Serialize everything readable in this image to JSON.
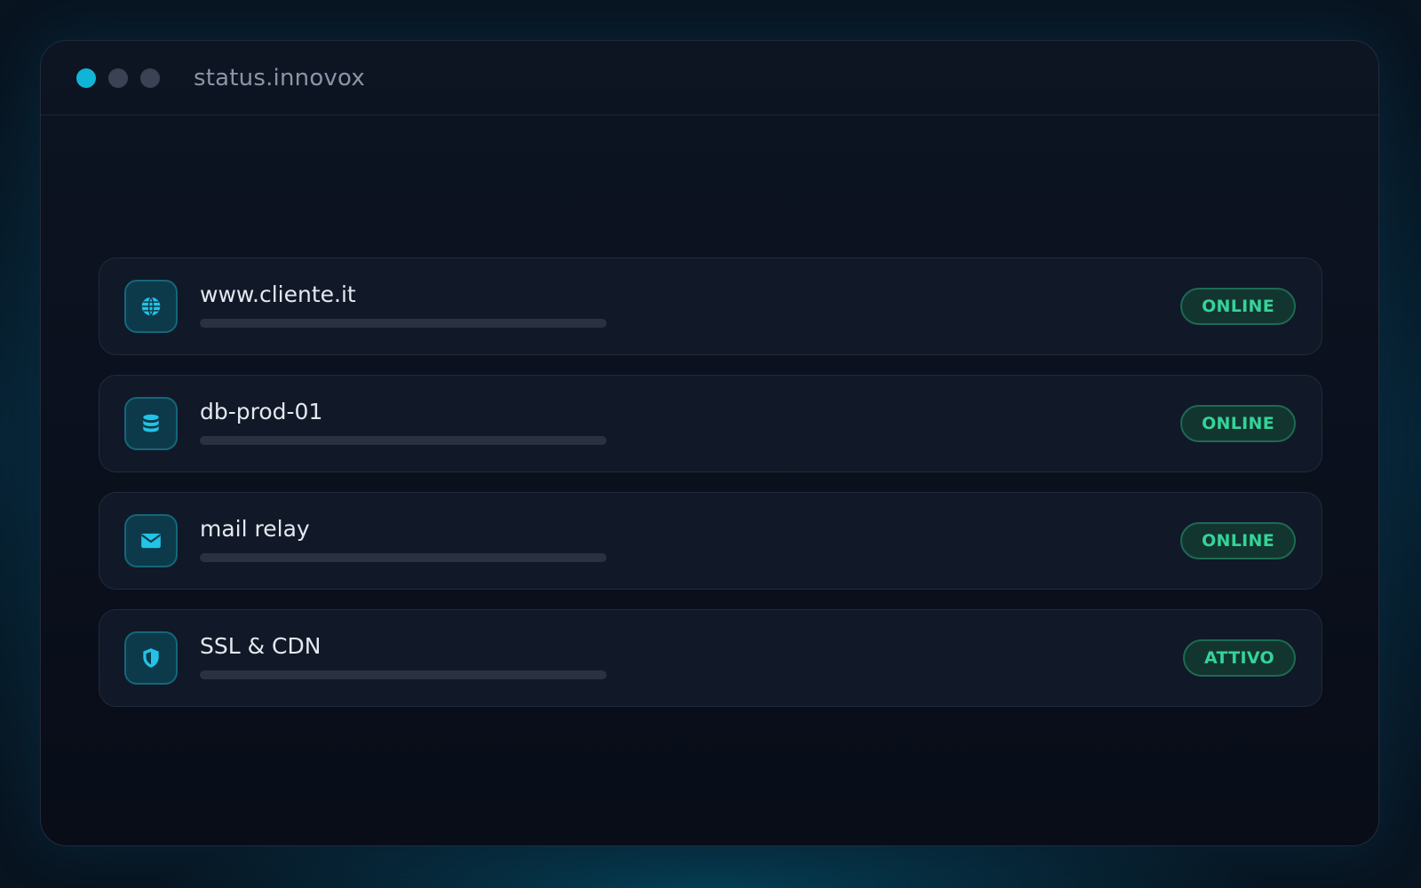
{
  "window": {
    "title": "status.innovox",
    "dots": [
      "active",
      "inactive",
      "inactive"
    ]
  },
  "colors": {
    "accent": "#10b5d6",
    "status_ok": "#34d399",
    "row_bg": "#111827",
    "bar": "#2a3140"
  },
  "services": [
    {
      "name": "www.cliente.it",
      "icon": "globe-icon",
      "status": "ONLINE"
    },
    {
      "name": "db-prod-01",
      "icon": "database-icon",
      "status": "ONLINE"
    },
    {
      "name": "mail relay",
      "icon": "mail-icon",
      "status": "ONLINE"
    },
    {
      "name": "SSL & CDN",
      "icon": "shield-icon",
      "status": "ATTIVO"
    }
  ]
}
